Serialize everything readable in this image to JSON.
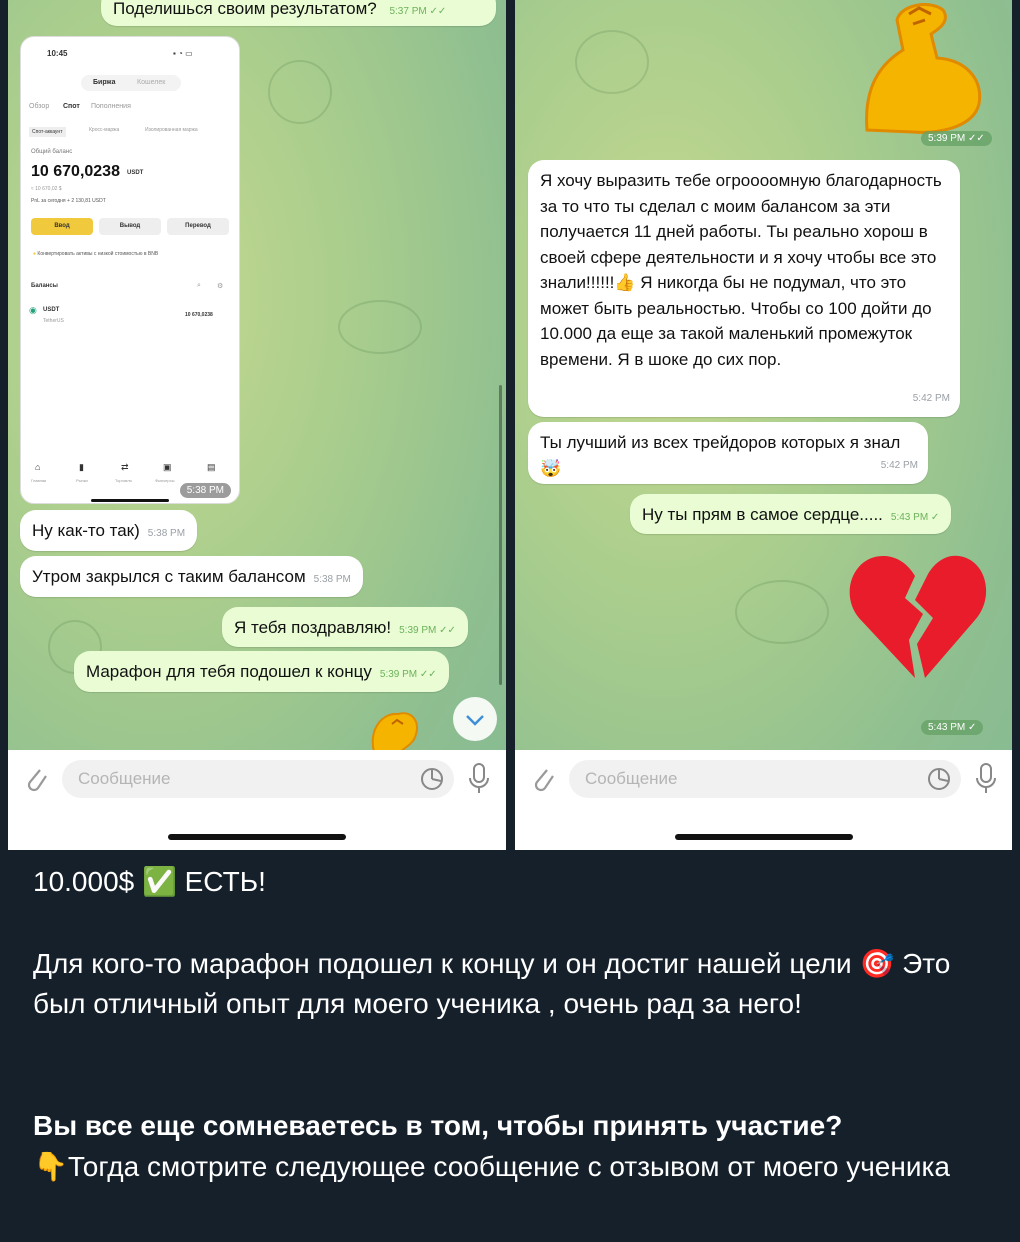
{
  "left_chat": {
    "top_message": {
      "text": "Поделишься своим результатом?",
      "time": "5:37 PM ✓✓"
    },
    "screenshot": {
      "status_time": "10:45",
      "tabs": [
        "Биржа",
        "Кошелек"
      ],
      "subtabs": [
        "Обзор",
        "Спот",
        "Пополнения"
      ],
      "account_tabs": [
        "Спот-аккаунт",
        "Кросс-маржа",
        "Изолированная маржа"
      ],
      "balance_label": "Общий баланс",
      "balance_value": "10 670,0238",
      "balance_unit": "USDT",
      "balance_sub": "≈ 10 670,02 $",
      "pnl": "PnL за сегодня + 2 130,81 USDT",
      "buttons": [
        "Ввод",
        "Вывод",
        "Перевод"
      ],
      "convert_note": "Конвертировать активы с низкой стоимостью в BNB",
      "balances_label": "Балансы",
      "asset_name": "USDT",
      "asset_sub": "TetherUS",
      "asset_value": "10 670,0238",
      "nav": [
        "Главная",
        "Рынки",
        "Торговля",
        "Фьючерсы",
        "Кошельки"
      ],
      "time": "5:38 PM"
    },
    "messages": [
      {
        "text": "Ну как-то так)",
        "time": "5:38 PM"
      },
      {
        "text": "Утром закрылся с таким балансом",
        "time": "5:38 PM"
      },
      {
        "text": "Я тебя поздравляю!",
        "time": "5:39 PM ✓✓"
      },
      {
        "text": "Марафон для тебя подошел к концу",
        "time": "5:39 PM ✓✓"
      }
    ],
    "input_placeholder": "Сообщение"
  },
  "right_chat": {
    "sticker_time": "5:39 PM ✓✓",
    "messages": [
      {
        "text": "Я хочу выразить тебе огроооомную благодарность за то что ты сделал с моим балансом за эти получается 11 дней работы. Ты реально хорош в своей сфере деятельности и я хочу чтобы все это знали!!!!!!👍 Я никогда бы не подумал, что это может быть реальностью. Чтобы со 100 дойти до 10.000 да еще за такой маленький промежуток времени. Я в шоке до сих пор.",
        "time": "5:42 PM"
      },
      {
        "text": "Ты лучший из всех трейдоров которых я знал 🤯",
        "time": "5:42 PM"
      },
      {
        "text": "Ну ты прям в самое сердце.....",
        "time": "5:43 PM ✓"
      }
    ],
    "heart_time": "5:43 PM ✓",
    "input_placeholder": "Сообщение"
  },
  "post": {
    "headline": "10.000$ ✅ ЕСТЬ!",
    "paragraph1": "Для кого-то марафон подошел к концу и он достиг нашей цели 🎯 Это был отличный опыт для моего ученика , очень рад за него!",
    "question": "Вы все еще сомневаетесь в том, чтобы принять участие?",
    "paragraph2": "👇Тогда смотрите следующее сообщение с отзывом от моего ученика"
  },
  "colors": {
    "accent_yellow": "#f0c93c",
    "out_bubble": "#e9fcd4",
    "post_bg": "#15202b"
  }
}
